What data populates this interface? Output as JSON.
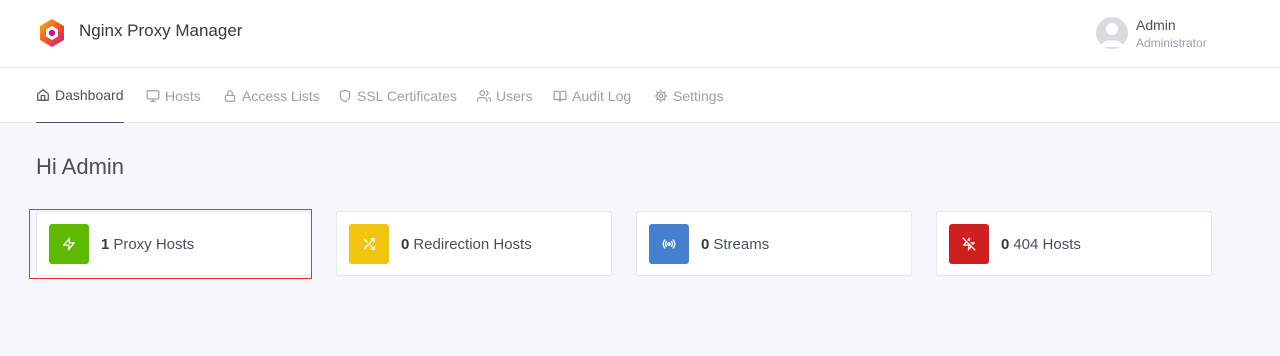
{
  "app": {
    "title": "Nginx Proxy Manager"
  },
  "user": {
    "name": "Admin",
    "role": "Administrator"
  },
  "nav": {
    "items": [
      {
        "label": "Dashboard",
        "icon": "home-icon",
        "active": true
      },
      {
        "label": "Hosts",
        "icon": "monitor-icon"
      },
      {
        "label": "Access Lists",
        "icon": "lock-icon"
      },
      {
        "label": "SSL Certificates",
        "icon": "shield-icon"
      },
      {
        "label": "Users",
        "icon": "users-icon"
      },
      {
        "label": "Audit Log",
        "icon": "book-open-icon"
      },
      {
        "label": "Settings",
        "icon": "gear-icon"
      }
    ]
  },
  "main": {
    "greeting": "Hi Admin",
    "cards": [
      {
        "count": "1",
        "label": "Proxy Hosts",
        "icon": "zap-icon",
        "color": "#5eba00",
        "selected": true
      },
      {
        "count": "0",
        "label": "Redirection Hosts",
        "icon": "shuffle-icon",
        "color": "#f1c40f"
      },
      {
        "count": "0",
        "label": "Streams",
        "icon": "radio-icon",
        "color": "#467fcf"
      },
      {
        "count": "0",
        "label": "404 Hosts",
        "icon": "zap-off-icon",
        "color": "#cd201f"
      }
    ]
  }
}
